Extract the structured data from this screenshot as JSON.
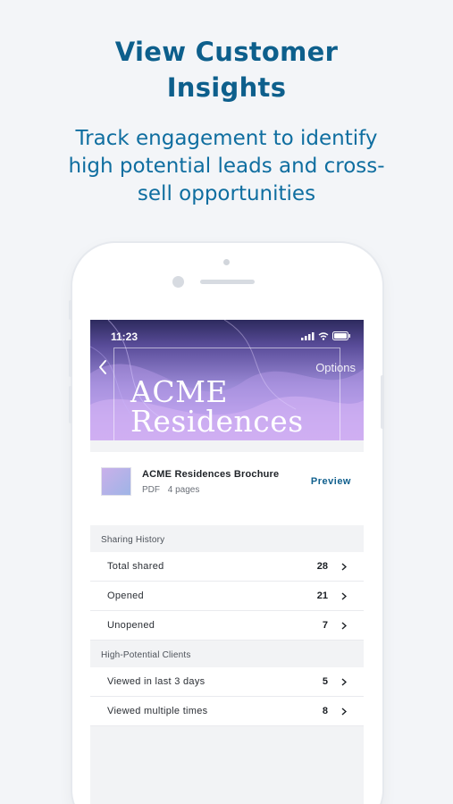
{
  "headline": {
    "line1": "View Customer",
    "line2": "Insights"
  },
  "subhead": {
    "line1": "Track engagement to identify",
    "line2": "high potential leads and cross-",
    "line3": "sell opportunities"
  },
  "status_bar": {
    "time": "11:23"
  },
  "nav": {
    "options_label": "Options"
  },
  "hero": {
    "line1": "ACME",
    "line2": "Residences"
  },
  "document": {
    "title": "ACME Residences Brochure",
    "type": "PDF",
    "pages": "4 pages",
    "preview_label": "Preview"
  },
  "sharing_history": {
    "header": "Sharing History",
    "rows": [
      {
        "label": "Total shared",
        "value": "28"
      },
      {
        "label": "Opened",
        "value": "21"
      },
      {
        "label": "Unopened",
        "value": "7"
      }
    ]
  },
  "high_potential": {
    "header": "High-Potential Clients",
    "rows": [
      {
        "label": "Viewed in last 3 days",
        "value": "5"
      },
      {
        "label": "Viewed multiple times",
        "value": "8"
      }
    ]
  },
  "colors": {
    "brand_blue": "#0d5f8c",
    "link_blue": "#11608e",
    "hero_purple": "#9b8ad6"
  },
  "icons": [
    "back-chevron-icon",
    "signal-icon",
    "wifi-icon",
    "battery-icon",
    "chevron-right-icon",
    "document-thumbnail"
  ]
}
